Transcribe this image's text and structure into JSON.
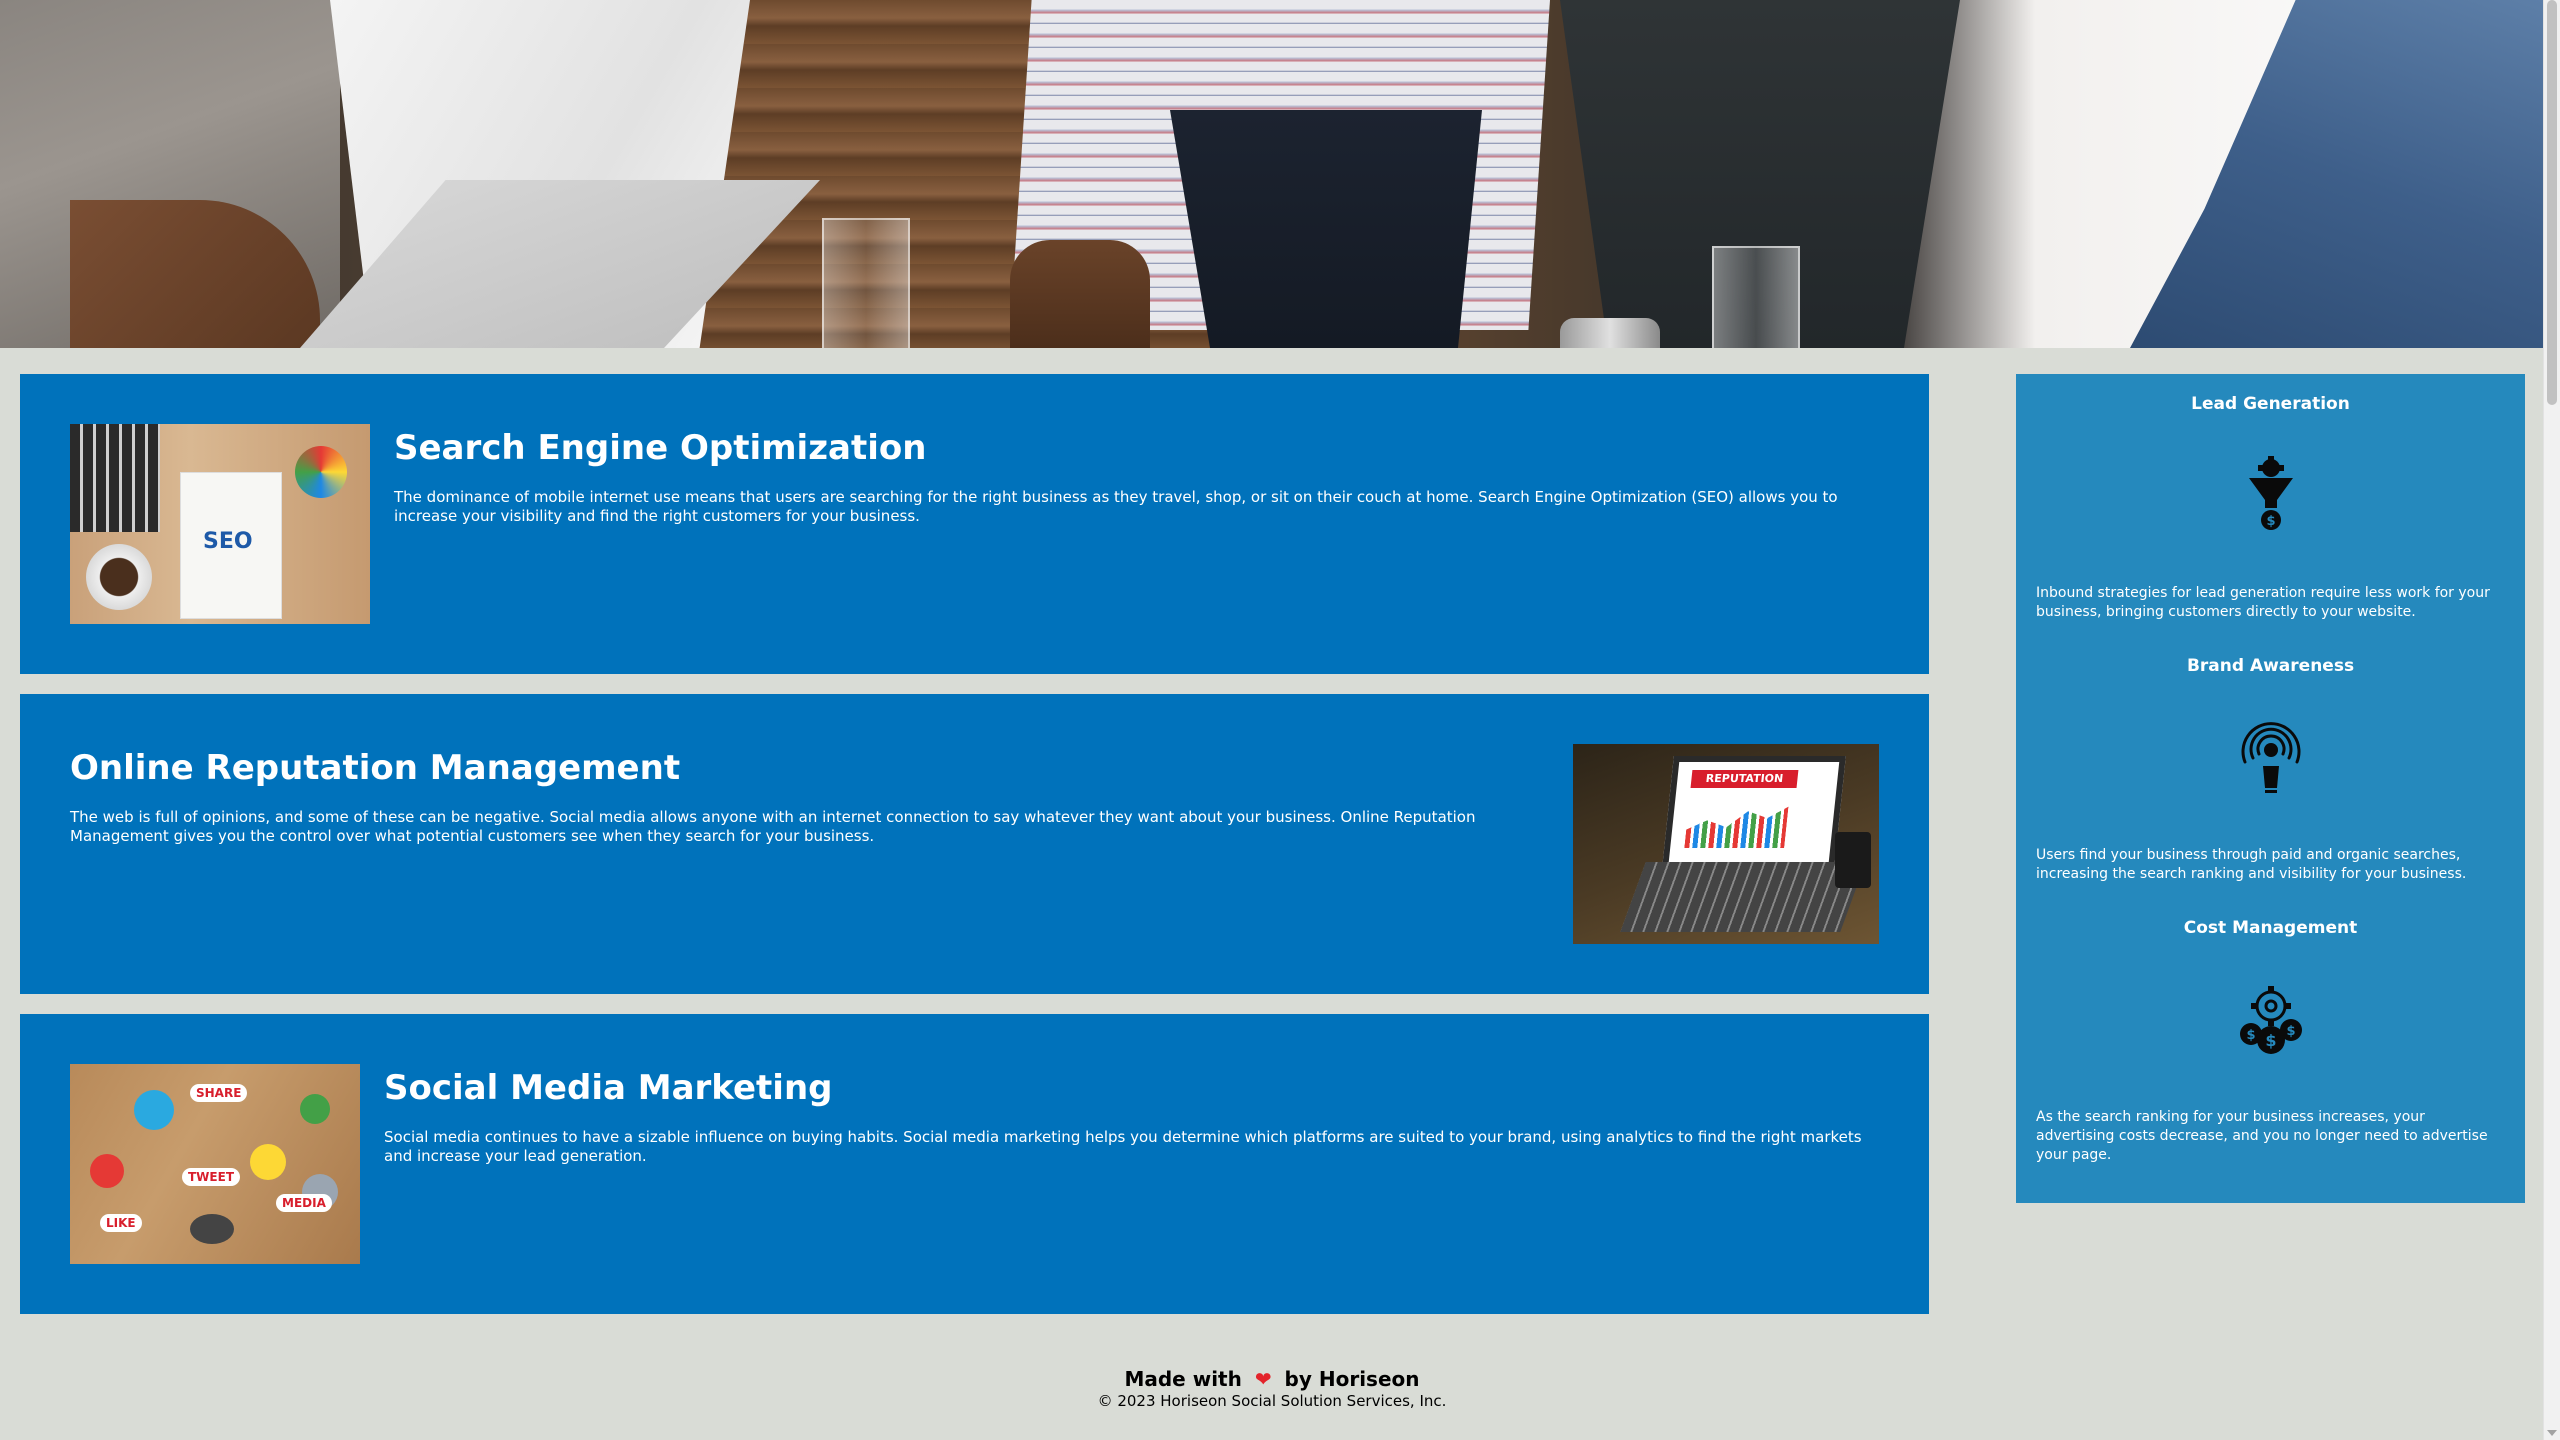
{
  "hero": {
    "image_alt": "Team meeting photo"
  },
  "cards": [
    {
      "title": "Search Engine Optimization",
      "body": "The dominance of mobile internet use means that users are searching for the right business as they travel, shop, or sit on their couch at home. Search Engine Optimization (SEO) allows you to increase your visibility and find the right customers for your business.",
      "image_text": "SEO",
      "image_icon": "seo-image"
    },
    {
      "title": "Online Reputation Management",
      "body": "The web is full of opinions, and some of these can be negative. Social media allows anyone with an internet connection to say whatever they want about your business. Online Reputation Management gives you the control over what potential customers see when they search for your business.",
      "image_text": "REPUTATION",
      "image_icon": "reputation-image"
    },
    {
      "title": "Social Media Marketing",
      "body": "Social media continues to have a sizable influence on buying habits. Social media marketing helps you determine which platforms are suited to your brand, using analytics to find the right markets and increase your lead generation.",
      "image_words": [
        "SHARE",
        "TWEET",
        "LIKE",
        "MEDIA"
      ],
      "image_icon": "social-media-image"
    }
  ],
  "benefits": [
    {
      "title": "Lead Generation",
      "icon": "funnel-dollar-icon",
      "body": "Inbound strategies for lead generation require less work for your business, bringing customers directly to your website."
    },
    {
      "title": "Brand Awareness",
      "icon": "lightbulb-icon",
      "body": "Users find your business through paid and organic searches, increasing the search ranking and visibility for your business."
    },
    {
      "title": "Cost Management",
      "icon": "gear-coins-icon",
      "body": "As the search ranking for your business increases, your advertising costs decrease, and you no longer need to advertise your page."
    }
  ],
  "footer": {
    "made_with": "Made with",
    "by": "by Horiseon",
    "heart": "❤",
    "copyright": "© 2023 Horiseon Social Solution Services, Inc."
  },
  "colors": {
    "background": "#d9dcd6",
    "card": "#0072bb",
    "sidebar": "#2589bd",
    "heart": "#e3242b"
  }
}
